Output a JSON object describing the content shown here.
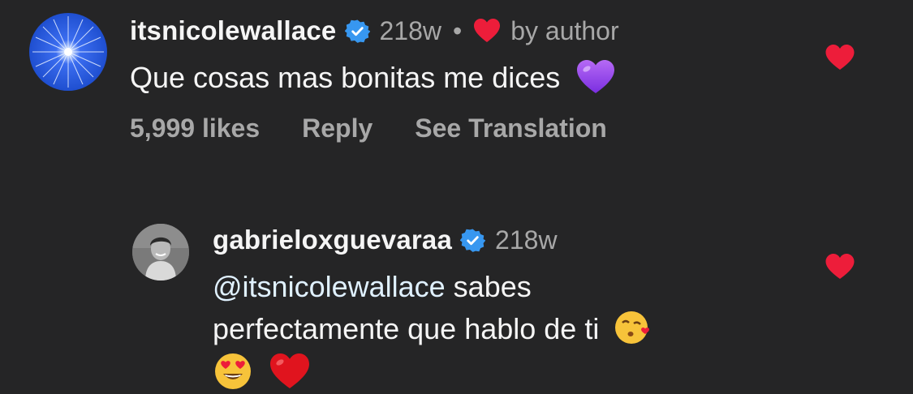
{
  "comments": [
    {
      "username": "itsnicolewallace",
      "time": "218w",
      "separator": "•",
      "author_like_label": "by author",
      "text": "Que cosas mas bonitas me dices",
      "emoji": "purple-heart",
      "actions": {
        "likes": "5,999 likes",
        "reply": "Reply",
        "translate": "See Translation"
      }
    },
    {
      "username": "gabrieloxguevaraa",
      "time": "218w",
      "mention": "@itsnicolewallace",
      "text_line1": " sabes",
      "text_line2": "perfectamente que hablo de ti",
      "emojis": [
        "kissing-heart-face",
        "heart-eyes-face",
        "red-heart"
      ]
    }
  ],
  "colors": {
    "background": "#252526",
    "text": "#f5f5f5",
    "muted": "#a8a8a8",
    "verified": "#3797f0",
    "heart": "#ed1d3a",
    "mention": "#e0f1ff"
  }
}
